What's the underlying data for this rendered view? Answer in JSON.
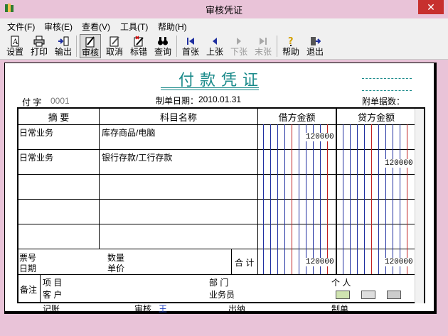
{
  "window": {
    "title": "审核凭证",
    "close_symbol": "✕"
  },
  "menu": [
    "文件(F)",
    "审核(E)",
    "查看(V)",
    "工具(T)",
    "帮助(H)"
  ],
  "toolbar": [
    {
      "label": "设置",
      "icon": "settings-icon",
      "state": "normal"
    },
    {
      "label": "打印",
      "icon": "print-icon",
      "state": "normal"
    },
    {
      "label": "输出",
      "icon": "export-icon",
      "state": "normal"
    },
    {
      "label": "审核",
      "icon": "review-icon",
      "state": "active"
    },
    {
      "label": "取消",
      "icon": "cancel-icon",
      "state": "normal"
    },
    {
      "label": "标错",
      "icon": "mark-error-icon",
      "state": "normal"
    },
    {
      "label": "查询",
      "icon": "binoculars-icon",
      "state": "normal"
    },
    {
      "label": "首张",
      "icon": "first-icon",
      "state": "normal"
    },
    {
      "label": "上张",
      "icon": "prev-icon",
      "state": "normal"
    },
    {
      "label": "下张",
      "icon": "next-icon",
      "state": "disabled"
    },
    {
      "label": "末张",
      "icon": "last-icon",
      "state": "disabled"
    },
    {
      "label": "帮助",
      "icon": "help-icon",
      "state": "normal"
    },
    {
      "label": "退出",
      "icon": "exit-icon",
      "state": "normal"
    }
  ],
  "voucher": {
    "title": "付款凭证",
    "type_label": "付 字",
    "number": "0001",
    "date_label": "制单日期：",
    "date": "2010.01.31",
    "attachments_label": "附单据数：",
    "columns": [
      "摘 要",
      "科目名称",
      "借方金额",
      "贷方金额"
    ],
    "rows": [
      {
        "summary": "日常业务",
        "account": "库存商品/电脑",
        "debit": "120000",
        "credit": ""
      },
      {
        "summary": "日常业务",
        "account": "银行存款/工行存款",
        "debit": "",
        "credit": "120000"
      },
      {
        "summary": "",
        "account": "",
        "debit": "",
        "credit": ""
      },
      {
        "summary": "",
        "account": "",
        "debit": "",
        "credit": ""
      },
      {
        "summary": "",
        "account": "",
        "debit": "",
        "credit": ""
      }
    ],
    "ticket_no_label": "票号",
    "date_label2": "日期",
    "quantity_label": "数量",
    "price_label": "单价",
    "total_label": "合 计",
    "total_debit": "120000",
    "total_credit": "120000",
    "remark_label": "备注",
    "project_label": "项 目",
    "customer_label": "客 户",
    "dept_label": "部 门",
    "salesman_label": "业务员",
    "person_label": "个 人",
    "bookkeeper_label": "记账",
    "reviewer_label": "审核",
    "reviewer_name": "王",
    "cashier_label": "出纳",
    "preparer_label": "制单"
  },
  "colors": {
    "title": "#1a8a8a",
    "blue_line": "#1f2fa0",
    "red_line": "#c02020",
    "reviewer": "#1f3fbf"
  }
}
